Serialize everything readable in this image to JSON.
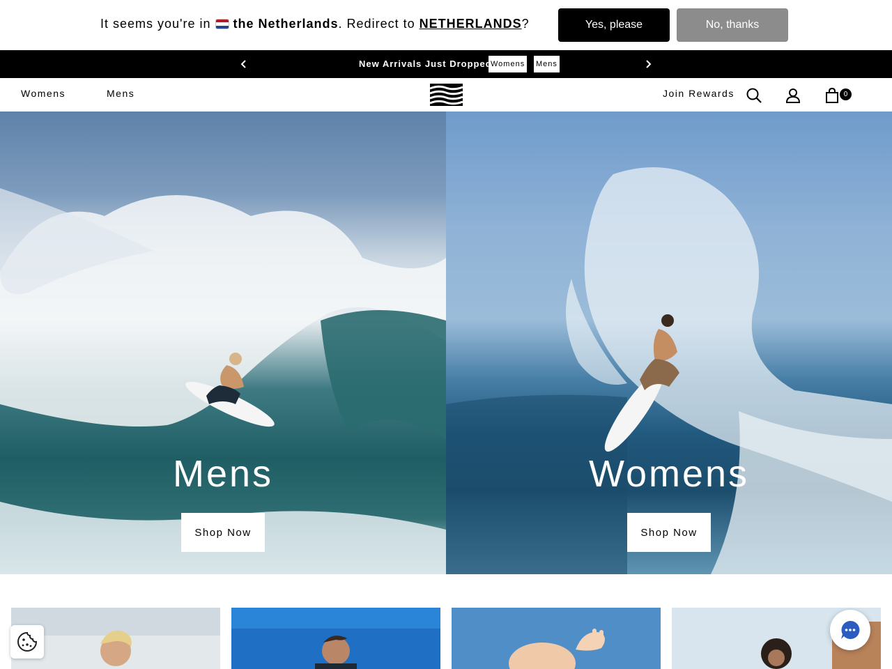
{
  "geo_redirect": {
    "text_prefix": "It seems you're in",
    "country": "the Netherlands",
    "text_middle": ". Redirect to",
    "target": "NETHERLANDS",
    "text_suffix": "?",
    "yes_label": "Yes, please",
    "no_label": "No, thanks",
    "flag_colors": [
      "#ae1c28",
      "#ffffff",
      "#21468b"
    ]
  },
  "announcement": {
    "message": "New Arrivals Just Dropped",
    "links": [
      "Womens",
      "Mens"
    ],
    "prev_icon": "chevron-left-icon",
    "next_icon": "chevron-right-icon"
  },
  "header": {
    "nav": [
      "Womens",
      "Mens"
    ],
    "logo": "billabong-logo",
    "join_label": "Join Rewards",
    "icons": [
      "search-icon",
      "account-icon",
      "bag-icon"
    ],
    "cart_count": "0"
  },
  "hero": {
    "panels": [
      {
        "title": "Mens",
        "button": "Shop Now"
      },
      {
        "title": "Womens",
        "button": "Shop Now"
      }
    ]
  },
  "categories": {
    "tile_count": 4
  },
  "floating": {
    "cookie_icon": "cookie-icon",
    "chat_icon": "chat-icon"
  }
}
